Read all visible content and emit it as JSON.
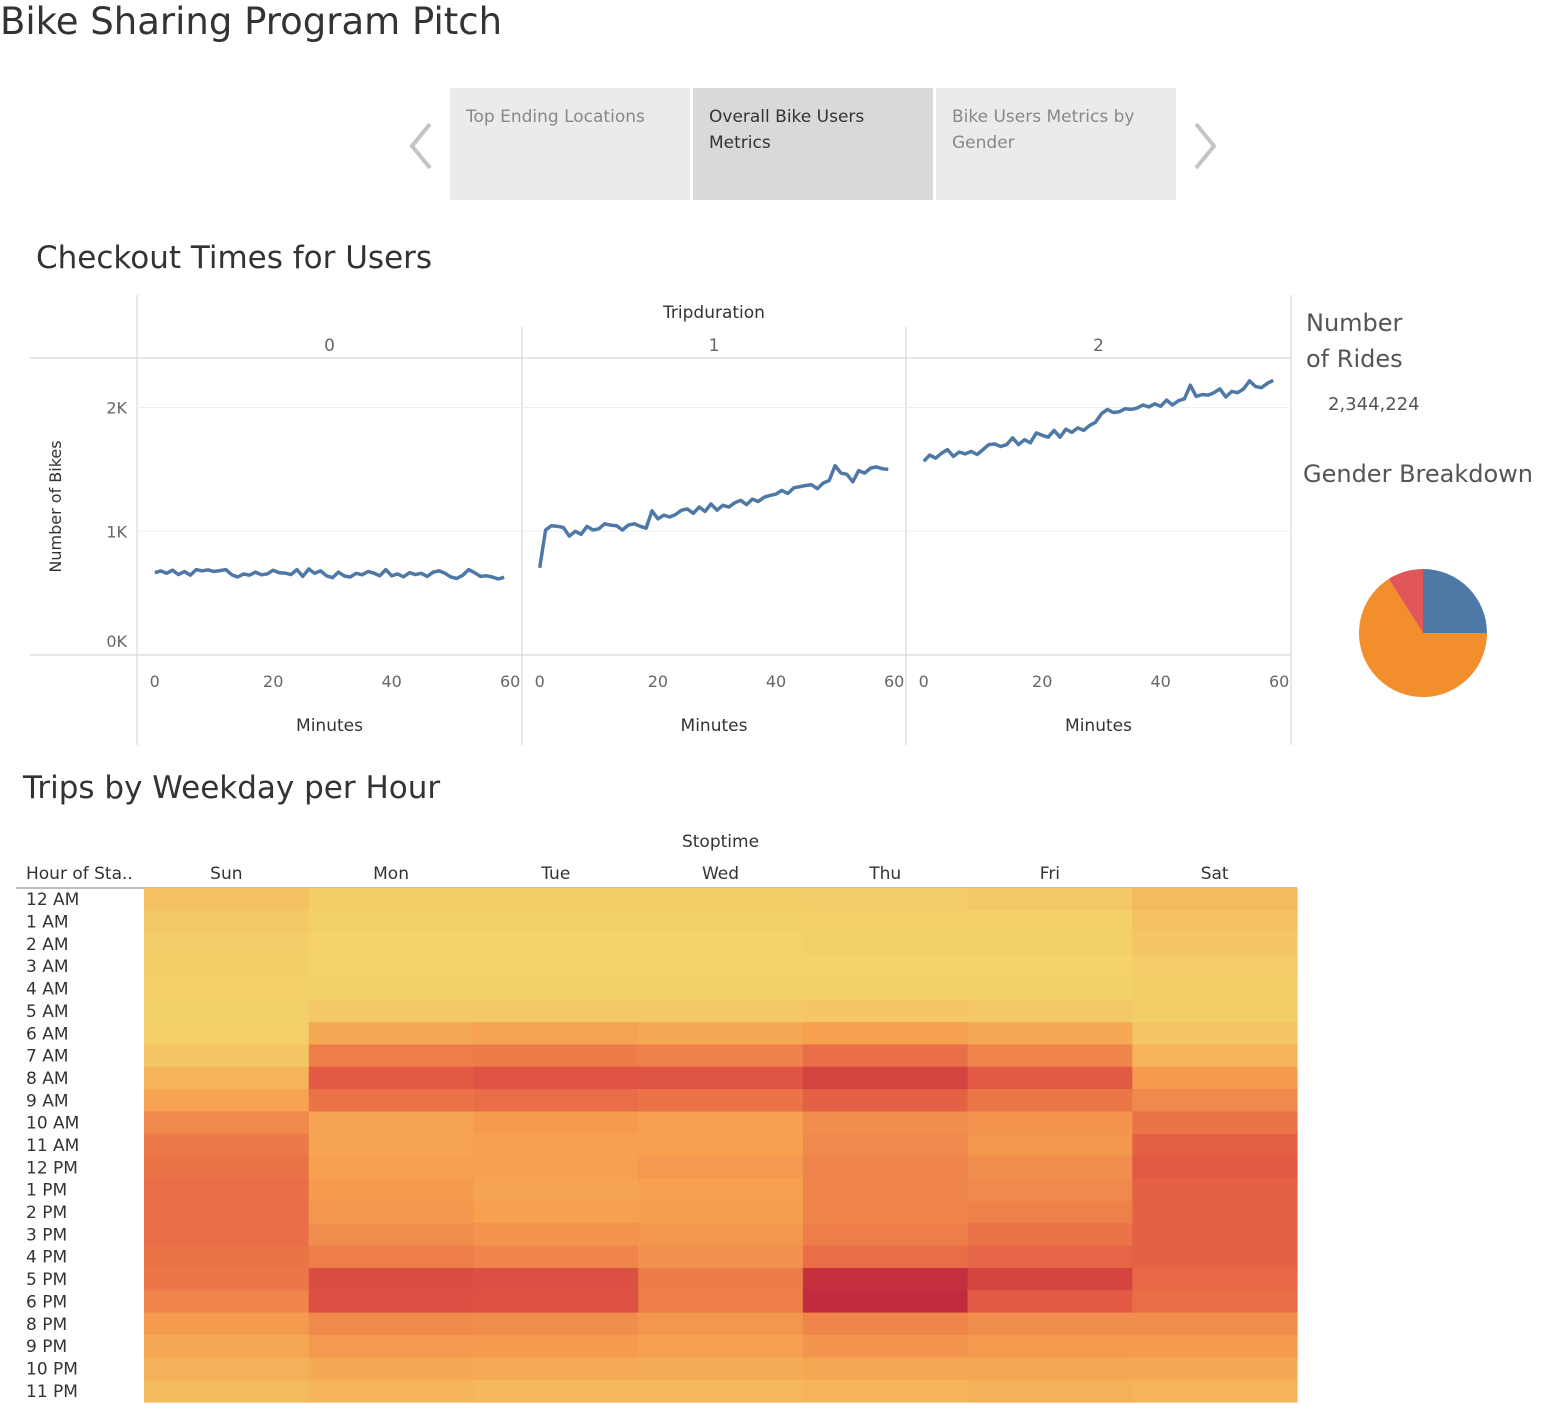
{
  "story": {
    "title": "Bike Sharing Program Pitch",
    "tabs": [
      {
        "label": "Top Ending Locations",
        "active": false
      },
      {
        "label": "Overall Bike Users Metrics",
        "active": true
      },
      {
        "label": "Bike Users Metrics by Gender",
        "active": false
      }
    ],
    "prev_icon": "chevron-left-icon",
    "next_icon": "chevron-right-icon"
  },
  "checkout": {
    "title": "Checkout Times for Users"
  },
  "rides": {
    "label_line1": "Number",
    "label_line2": "of Rides",
    "value": "2,344,224"
  },
  "gender": {
    "title": "Gender Breakdown"
  },
  "trips": {
    "title": "Trips by Weekday per Hour"
  },
  "colors": {
    "line": "#4e79a7",
    "pie": [
      "#4e79a7",
      "#f28e2b",
      "#e15759"
    ]
  },
  "chart_data": [
    {
      "type": "line",
      "title": "Checkout Times for Users",
      "column_header": "Tripduration",
      "panels": [
        "0",
        "1",
        "2"
      ],
      "xlabel": "Minutes",
      "ylabel": "Number of Bikes",
      "x_ticks": [
        0,
        20,
        40,
        60
      ],
      "y_ticks": [
        "0K",
        "1K",
        "2K"
      ],
      "ylim": [
        0,
        2400
      ],
      "xlim": [
        -3,
        62
      ],
      "grid": true,
      "x": [
        0,
        1,
        2,
        3,
        4,
        5,
        6,
        7,
        8,
        9,
        10,
        11,
        12,
        13,
        14,
        15,
        16,
        17,
        18,
        19,
        20,
        21,
        22,
        23,
        24,
        25,
        26,
        27,
        28,
        29,
        30,
        31,
        32,
        33,
        34,
        35,
        36,
        37,
        38,
        39,
        40,
        41,
        42,
        43,
        44,
        45,
        46,
        47,
        48,
        49,
        50,
        51,
        52,
        53,
        54,
        55,
        56,
        57,
        58,
        59
      ],
      "series": [
        {
          "panel": "0",
          "values": [
            665,
            680,
            660,
            685,
            650,
            675,
            645,
            690,
            680,
            688,
            675,
            682,
            690,
            648,
            630,
            655,
            645,
            670,
            648,
            655,
            685,
            665,
            662,
            650,
            690,
            635,
            695,
            660,
            680,
            640,
            625,
            670,
            638,
            630,
            660,
            648,
            675,
            662,
            640,
            690,
            640,
            655,
            632,
            665,
            650,
            660,
            635,
            670,
            680,
            660,
            630,
            618,
            645,
            690,
            665,
            635,
            640,
            630,
            615,
            628
          ]
        },
        {
          "panel": "1",
          "values": [
            705,
            1010,
            1045,
            1040,
            1030,
            960,
            1000,
            975,
            1040,
            1010,
            1020,
            1060,
            1050,
            1045,
            1010,
            1050,
            1060,
            1040,
            1025,
            1165,
            1100,
            1130,
            1115,
            1135,
            1170,
            1180,
            1145,
            1195,
            1160,
            1220,
            1170,
            1210,
            1195,
            1230,
            1250,
            1215,
            1260,
            1240,
            1275,
            1290,
            1300,
            1330,
            1305,
            1350,
            1360,
            1370,
            1375,
            1345,
            1390,
            1410,
            1530,
            1470,
            1460,
            1400,
            1490,
            1470,
            1510,
            1520,
            1505,
            1500
          ]
        },
        {
          "panel": "2",
          "values": [
            1565,
            1615,
            1590,
            1630,
            1660,
            1605,
            1640,
            1625,
            1645,
            1620,
            1660,
            1700,
            1705,
            1685,
            1700,
            1755,
            1700,
            1740,
            1715,
            1795,
            1775,
            1760,
            1815,
            1760,
            1825,
            1800,
            1835,
            1815,
            1855,
            1880,
            1950,
            1985,
            1960,
            1965,
            1990,
            1985,
            1995,
            2020,
            2005,
            2030,
            2010,
            2060,
            2020,
            2055,
            2070,
            2180,
            2090,
            2105,
            2100,
            2120,
            2150,
            2085,
            2130,
            2120,
            2150,
            2215,
            2170,
            2160,
            2195,
            2220
          ]
        }
      ]
    },
    {
      "type": "pie",
      "title": "Gender Breakdown",
      "values": [
        0.25,
        0.66,
        0.09
      ]
    },
    {
      "type": "heatmap",
      "title": "Trips by Weekday per Hour",
      "column_header": "Stoptime",
      "row_header": "Hour of Sta..",
      "columns": [
        "Sun",
        "Mon",
        "Tue",
        "Wed",
        "Thu",
        "Fri",
        "Sat"
      ],
      "rows": [
        "12 AM",
        "1 AM",
        "2 AM",
        "3 AM",
        "4 AM",
        "5 AM",
        "6 AM",
        "7 AM",
        "8 AM",
        "9 AM",
        "10 AM",
        "11 AM",
        "12 PM",
        "1 PM",
        "2 PM",
        "3 PM",
        "4 PM",
        "5 PM",
        "6 PM",
        "8 PM",
        "9 PM",
        "10 PM",
        "11 PM"
      ],
      "values": [
        [
          0.1,
          0.03,
          0.03,
          0.03,
          0.04,
          0.06,
          0.15
        ],
        [
          0.06,
          0.01,
          0.01,
          0.01,
          0.02,
          0.02,
          0.1
        ],
        [
          0.04,
          0.0,
          0.0,
          0.0,
          0.01,
          0.01,
          0.07
        ],
        [
          0.03,
          0.0,
          0.0,
          0.0,
          0.0,
          0.0,
          0.05
        ],
        [
          0.02,
          0.01,
          0.01,
          0.01,
          0.01,
          0.01,
          0.03
        ],
        [
          0.01,
          0.06,
          0.06,
          0.06,
          0.07,
          0.06,
          0.03
        ],
        [
          0.02,
          0.25,
          0.28,
          0.25,
          0.3,
          0.25,
          0.08
        ],
        [
          0.08,
          0.45,
          0.46,
          0.44,
          0.52,
          0.42,
          0.18
        ],
        [
          0.18,
          0.62,
          0.65,
          0.64,
          0.74,
          0.62,
          0.32
        ],
        [
          0.28,
          0.5,
          0.52,
          0.5,
          0.58,
          0.48,
          0.4
        ],
        [
          0.4,
          0.28,
          0.32,
          0.3,
          0.38,
          0.35,
          0.5
        ],
        [
          0.47,
          0.28,
          0.3,
          0.3,
          0.4,
          0.34,
          0.58
        ],
        [
          0.5,
          0.3,
          0.3,
          0.33,
          0.42,
          0.38,
          0.62
        ],
        [
          0.52,
          0.32,
          0.28,
          0.3,
          0.42,
          0.4,
          0.58
        ],
        [
          0.52,
          0.34,
          0.3,
          0.31,
          0.42,
          0.44,
          0.58
        ],
        [
          0.52,
          0.38,
          0.35,
          0.34,
          0.45,
          0.5,
          0.58
        ],
        [
          0.5,
          0.45,
          0.42,
          0.36,
          0.52,
          0.56,
          0.58
        ],
        [
          0.48,
          0.68,
          0.67,
          0.46,
          0.85,
          0.74,
          0.55
        ],
        [
          0.42,
          0.67,
          0.66,
          0.45,
          0.88,
          0.62,
          0.52
        ],
        [
          0.32,
          0.4,
          0.38,
          0.34,
          0.42,
          0.38,
          0.38
        ],
        [
          0.26,
          0.33,
          0.32,
          0.3,
          0.35,
          0.32,
          0.32
        ],
        [
          0.2,
          0.25,
          0.24,
          0.23,
          0.26,
          0.26,
          0.25
        ],
        [
          0.14,
          0.18,
          0.16,
          0.16,
          0.18,
          0.2,
          0.18
        ]
      ]
    }
  ]
}
